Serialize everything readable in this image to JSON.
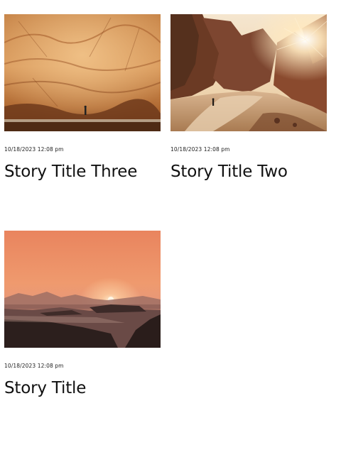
{
  "stories": [
    {
      "date": "10/18/2023 12:08 pm",
      "title": "Story Title Three",
      "image": "sandstone-cave-hiker-photo"
    },
    {
      "date": "10/18/2023 12:08 pm",
      "title": "Story Title Two",
      "image": "canyon-sunburst-hiker-photo"
    },
    {
      "date": "10/18/2023 12:08 pm",
      "title": "Story Title",
      "image": "desert-sunset-photo"
    }
  ],
  "colors": {
    "text": "#111111",
    "background": "#ffffff"
  }
}
